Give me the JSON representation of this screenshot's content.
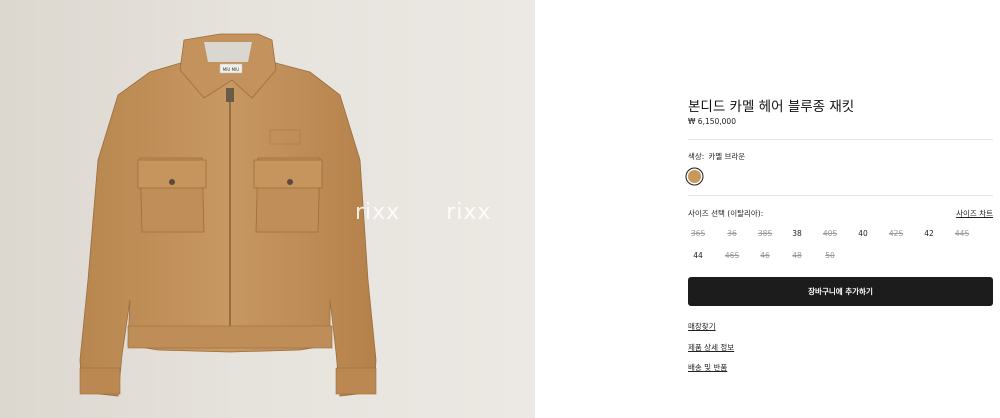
{
  "product": {
    "title": "본디드 카멜 헤어 블루종 재킷",
    "price": "₩ 6,150,000"
  },
  "watermark": [
    "rixx",
    "rixx",
    "rixx"
  ],
  "label_brand": "MIU MIU",
  "color": {
    "label": "색상:",
    "value": "카멜 브라운",
    "swatch_hex": "#c9975c"
  },
  "size": {
    "label": "사이즈 선택 (이탈리아):",
    "chart_link": "사이즈 차트",
    "options": [
      {
        "label": "36S",
        "available": false
      },
      {
        "label": "36",
        "available": false
      },
      {
        "label": "38S",
        "available": false
      },
      {
        "label": "38",
        "available": true
      },
      {
        "label": "40S",
        "available": false
      },
      {
        "label": "40",
        "available": true
      },
      {
        "label": "42S",
        "available": false
      },
      {
        "label": "42",
        "available": true
      },
      {
        "label": "44S",
        "available": false
      },
      {
        "label": "44",
        "available": true
      },
      {
        "label": "46S",
        "available": false
      },
      {
        "label": "46",
        "available": false
      },
      {
        "label": "48",
        "available": false
      },
      {
        "label": "50",
        "available": false
      }
    ]
  },
  "actions": {
    "add_to_cart": "장바구니에 추가하기"
  },
  "links": {
    "store_finder": "매장찾기",
    "product_details": "제품 상세 정보",
    "shipping_returns": "배송 및 반품"
  },
  "colors": {
    "accent": "#1c1c1c",
    "camel": "#c9975c"
  }
}
